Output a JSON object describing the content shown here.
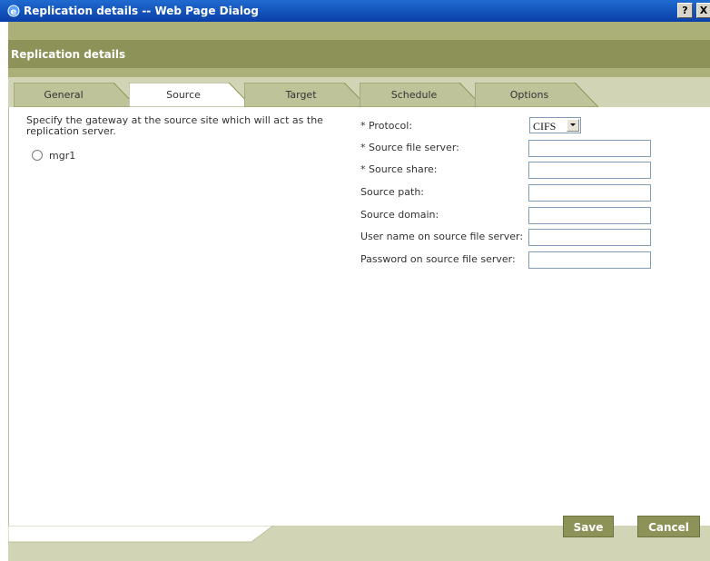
{
  "window": {
    "title": "Replication details -- Web Page Dialog",
    "help_label": "?",
    "close_label": "X"
  },
  "header": {
    "title": "Replication details"
  },
  "tabs": [
    {
      "label": "General",
      "active": false
    },
    {
      "label": "Source",
      "active": true
    },
    {
      "label": "Target",
      "active": false
    },
    {
      "label": "Schedule",
      "active": false
    },
    {
      "label": "Options",
      "active": false
    }
  ],
  "source": {
    "instructions": "Specify the gateway at the source site which will act as the replication server.",
    "gateways": [
      {
        "label": "mgr1",
        "selected": false
      }
    ]
  },
  "form": {
    "protocol_label": "* Protocol:",
    "protocol_value": "CIFS",
    "fields": [
      {
        "label": "* Source file server:",
        "value": ""
      },
      {
        "label": "* Source share:",
        "value": ""
      },
      {
        "label": "Source path:",
        "value": ""
      },
      {
        "label": "Source domain:",
        "value": ""
      },
      {
        "label": "User name on source file server:",
        "value": ""
      },
      {
        "label": "Password on source file server:",
        "value": ""
      }
    ]
  },
  "footer": {
    "save_label": "Save",
    "cancel_label": "Cancel"
  },
  "colors": {
    "frame": "#aab077",
    "header_band": "#8d9358",
    "tab_active": "#ffffff",
    "tab_inactive": "#bfc39a",
    "button": "#8d9358"
  }
}
